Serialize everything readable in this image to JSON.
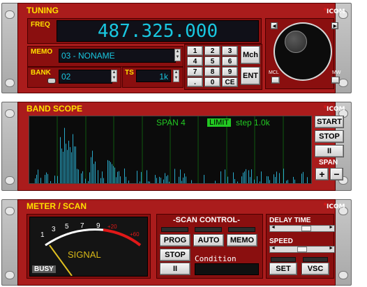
{
  "tuning": {
    "title": "TUNING",
    "logo": "ICOM",
    "freq_label": "FREQ",
    "freq_value": "487.325.000",
    "memo_label": "MEMO",
    "memo_value": "03 - NONAME",
    "bank_label": "BANK",
    "bank_value": "02",
    "ts_label": "TS",
    "ts_value": "1k",
    "keypad": [
      "1",
      "2",
      "3",
      "4",
      "5",
      "6",
      "7",
      "8",
      "9",
      ".",
      "0",
      "CE"
    ],
    "mch_label": "Mch",
    "ent_label": "ENT",
    "mcl_label": "MCL",
    "mw_label": "MW"
  },
  "scope": {
    "title": "BAND SCOPE",
    "logo": "ICOM",
    "span_text": "SPAN 4",
    "limit_badge": "LIMIT",
    "step_text": "step 1.0k",
    "start_label": "START",
    "stop_label": "STOP",
    "pause_label": "II",
    "span_label": "SPAN",
    "plus_label": "+",
    "minus_label": "−"
  },
  "meter": {
    "title": "METER / SCAN",
    "logo": "ICOM",
    "scale": [
      "1",
      "3",
      "5",
      "7",
      "9",
      "+20",
      "+60"
    ],
    "signal_label": "SIGNAL",
    "busy_label": "BUSY",
    "scan_control_label": "-SCAN CONTROL-",
    "prog_label": "PROG",
    "auto_label": "AUTO",
    "memo_label": "MEMO",
    "stop_label": "STOP",
    "pause_label": "II",
    "condition_label": "Condition",
    "delay_time_label": "DELAY TIME",
    "speed_label": "SPEED",
    "set_label": "SET",
    "vsc_label": "VSC",
    "needle_level": 0.05,
    "delay_level": 0.6,
    "speed_level": 0.5
  },
  "colors": {
    "panel_bg": "#aa1c1c",
    "lcd_bg": "#101018",
    "freq_digits": "#19c7e0",
    "label_yellow": "#ffe000",
    "scope_trace": "#29a8c8",
    "limit_green": "#22c822"
  }
}
